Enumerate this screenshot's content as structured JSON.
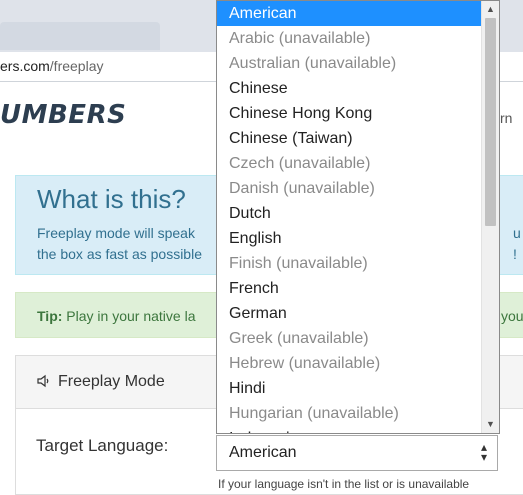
{
  "browser": {
    "url_host": "ers.com",
    "url_path": "/freeplay"
  },
  "site": {
    "logo_text": "UMBERS",
    "nav_fragment": "rn"
  },
  "info": {
    "heading": "What is this?",
    "line1": "Freeplay mode will speak",
    "line2": "the box as fast as possible",
    "frag1": "u n",
    "frag2": "!"
  },
  "tip": {
    "label": "Tip:",
    "text": "Play in your native la",
    "frag": "you"
  },
  "mode_card": {
    "icon": "speaker-icon",
    "title": "Freeplay Mode"
  },
  "target_language": {
    "label": "Target Language:",
    "selected": "American",
    "below_text": "If your language isn't in the list or is unavailable"
  },
  "dropdown": {
    "options": [
      {
        "label": "American",
        "state": "selected"
      },
      {
        "label": "Arabic (unavailable)",
        "state": "disabled"
      },
      {
        "label": "Australian (unavailable)",
        "state": "disabled"
      },
      {
        "label": "Chinese",
        "state": "enabled"
      },
      {
        "label": "Chinese Hong Kong",
        "state": "enabled"
      },
      {
        "label": "Chinese (Taiwan)",
        "state": "enabled"
      },
      {
        "label": "Czech (unavailable)",
        "state": "disabled"
      },
      {
        "label": "Danish (unavailable)",
        "state": "disabled"
      },
      {
        "label": "Dutch",
        "state": "enabled"
      },
      {
        "label": "English",
        "state": "enabled"
      },
      {
        "label": "Finish (unavailable)",
        "state": "disabled"
      },
      {
        "label": "French",
        "state": "enabled"
      },
      {
        "label": "German",
        "state": "enabled"
      },
      {
        "label": "Greek (unavailable)",
        "state": "disabled"
      },
      {
        "label": "Hebrew (unavailable)",
        "state": "disabled"
      },
      {
        "label": "Hindi",
        "state": "enabled"
      },
      {
        "label": "Hungarian (unavailable)",
        "state": "disabled"
      },
      {
        "label": "Indonesian",
        "state": "enabled"
      }
    ]
  },
  "colors": {
    "selected_bg": "#1e90ff",
    "info_bg": "#d9edf7",
    "tip_bg": "#dff0d8"
  }
}
